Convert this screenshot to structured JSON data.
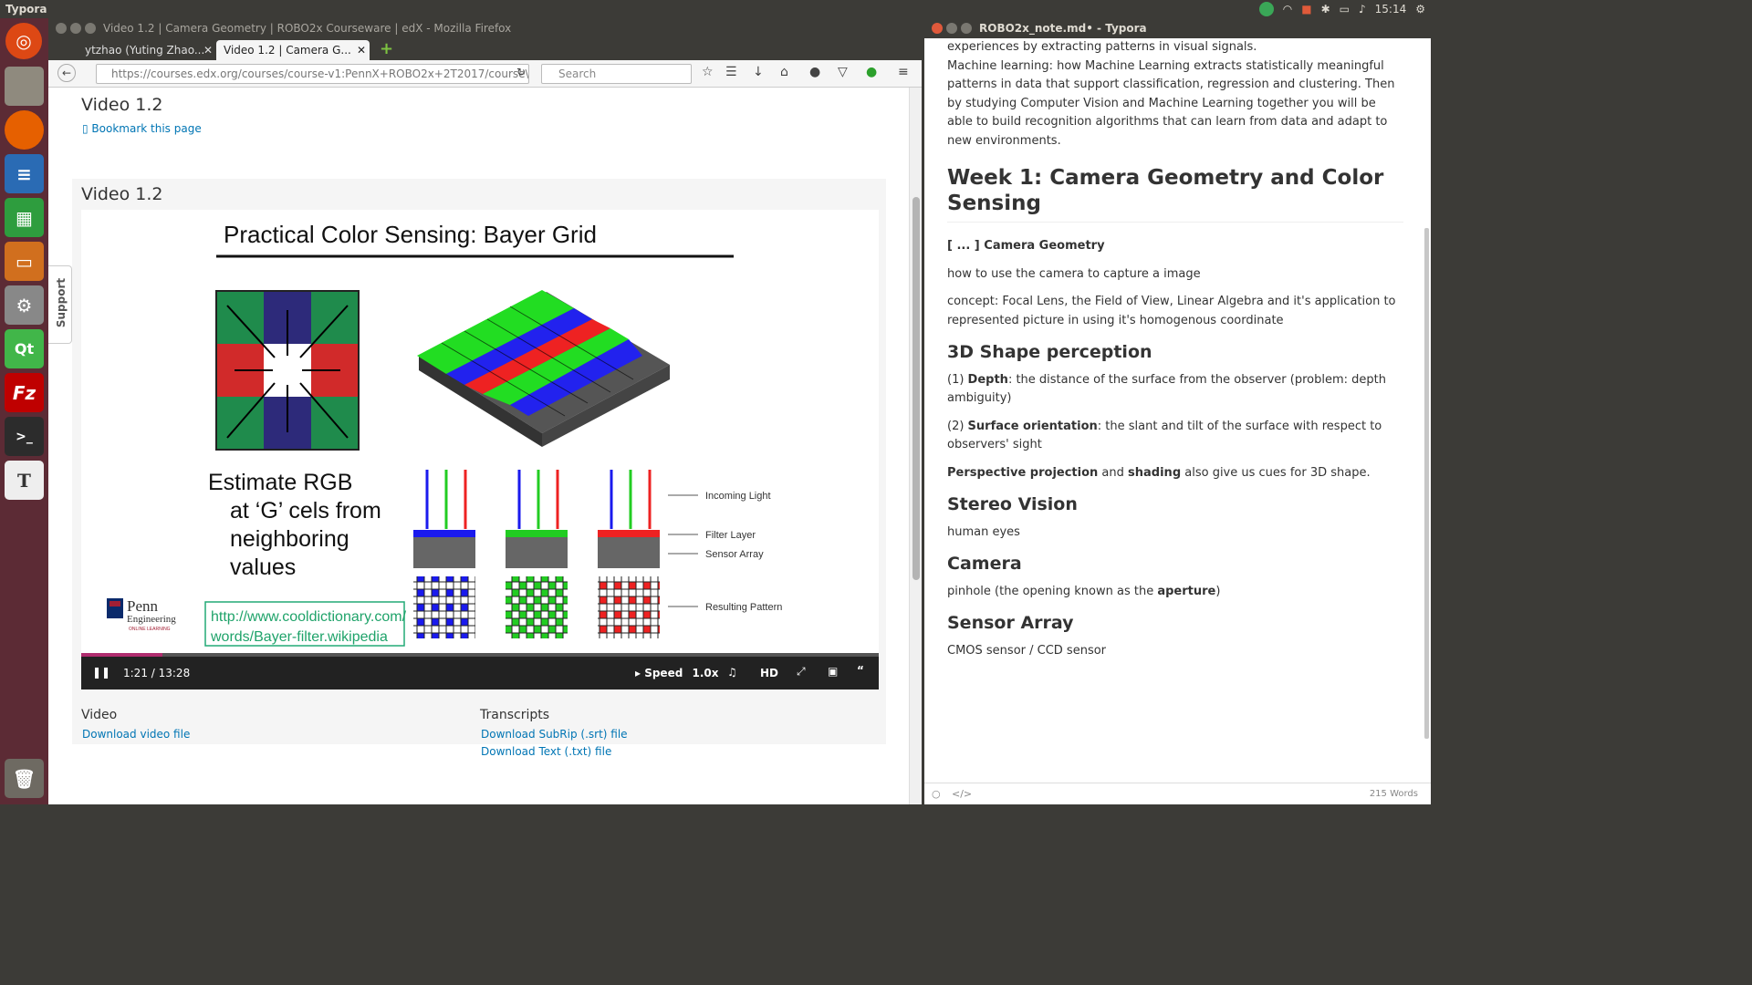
{
  "topbar": {
    "app_name": "Typora",
    "clock": "15:14"
  },
  "firefox": {
    "window_title": "Video 1.2 | Camera Geometry | ROBO2x Courseware | edX - Mozilla Firefox",
    "tabs": [
      {
        "label": "ytzhao (Yuting Zhao..."
      },
      {
        "label": "Video 1.2 | Camera G..."
      }
    ],
    "url": "https://courses.edx.org/courses/course-v1:PennX+ROBO2x+2T2017/course\\",
    "search_placeholder": "Search",
    "support_label": "Support",
    "page_title": "Video 1.2",
    "bookmark_label": "Bookmark this page",
    "video_title": "Video 1.2",
    "slide": {
      "title": "Practical Color Sensing: Bayer Grid",
      "caption_lines": [
        "Estimate RGB",
        "at ‘G’ cels from",
        "neighboring",
        "values"
      ],
      "labels": [
        "Incoming Light",
        "Filter Layer",
        "Sensor Array",
        "Resulting Pattern"
      ],
      "url_lines": [
        "http://www.cooldictionary.com/",
        "words/Bayer-filter.wikipedia"
      ],
      "logo_line1": "Penn",
      "logo_line2": "Engineering",
      "logo_line3": "ONLINE LEARNING"
    },
    "player": {
      "time": "1:21 / 13:28",
      "speed_label": "Speed",
      "speed_value": "1.0x",
      "hd": "HD",
      "progress": 0.102
    },
    "downloads": {
      "video_heading": "Video",
      "video_link": "Download video file",
      "transcripts_heading": "Transcripts",
      "srt_link": "Download SubRip (.srt) file",
      "txt_link": "Download Text (.txt) file"
    }
  },
  "typora": {
    "window_title": "ROBO2x_note.md• - Typora",
    "intro_line1": "experiences by extracting patterns in visual signals.",
    "intro_para": "Machine learning: how Machine Learning extracts statistically meaningful patterns in data that support classification, regression and clustering. Then by studying Computer Vision and Machine Learning together you will be able to build recognition algorithms that can learn from data and adapt to new environments.",
    "h1": "Week 1: Camera Geometry and Color Sensing",
    "cg_prefix": "[ ... ] ",
    "cg_bold": "Camera Geometry",
    "cg_line1": "how to use the camera to capture a image",
    "cg_line2": "concept: Focal Lens, the Field of View, Linear Algebra and it's application to represented picture in using it's homogenous coordinate",
    "h_3d": "3D Shape perception",
    "depth_prefix": "(1) ",
    "depth_bold": "Depth",
    "depth_rest": ": the distance of the surface from the observer (problem: depth ambiguity)",
    "surf_prefix": "(2) ",
    "surf_bold": "Surface orientation",
    "surf_rest": ": the slant and tilt of the surface with respect to observers' sight",
    "persp_bold": "Perspective projection",
    "persp_and": " and ",
    "persp_bold2": "shading",
    "persp_rest": " also give us cues for 3D shape.",
    "h_stereo": "Stereo Vision",
    "stereo_text": "human eyes",
    "h_camera": "Camera",
    "camera_prefix": "pinhole (the opening known as the ",
    "camera_bold": "aperture",
    "camera_suffix": ")",
    "h_sensor": "Sensor Array",
    "sensor_text": "CMOS sensor / CCD sensor",
    "word_count": "215 Words"
  }
}
